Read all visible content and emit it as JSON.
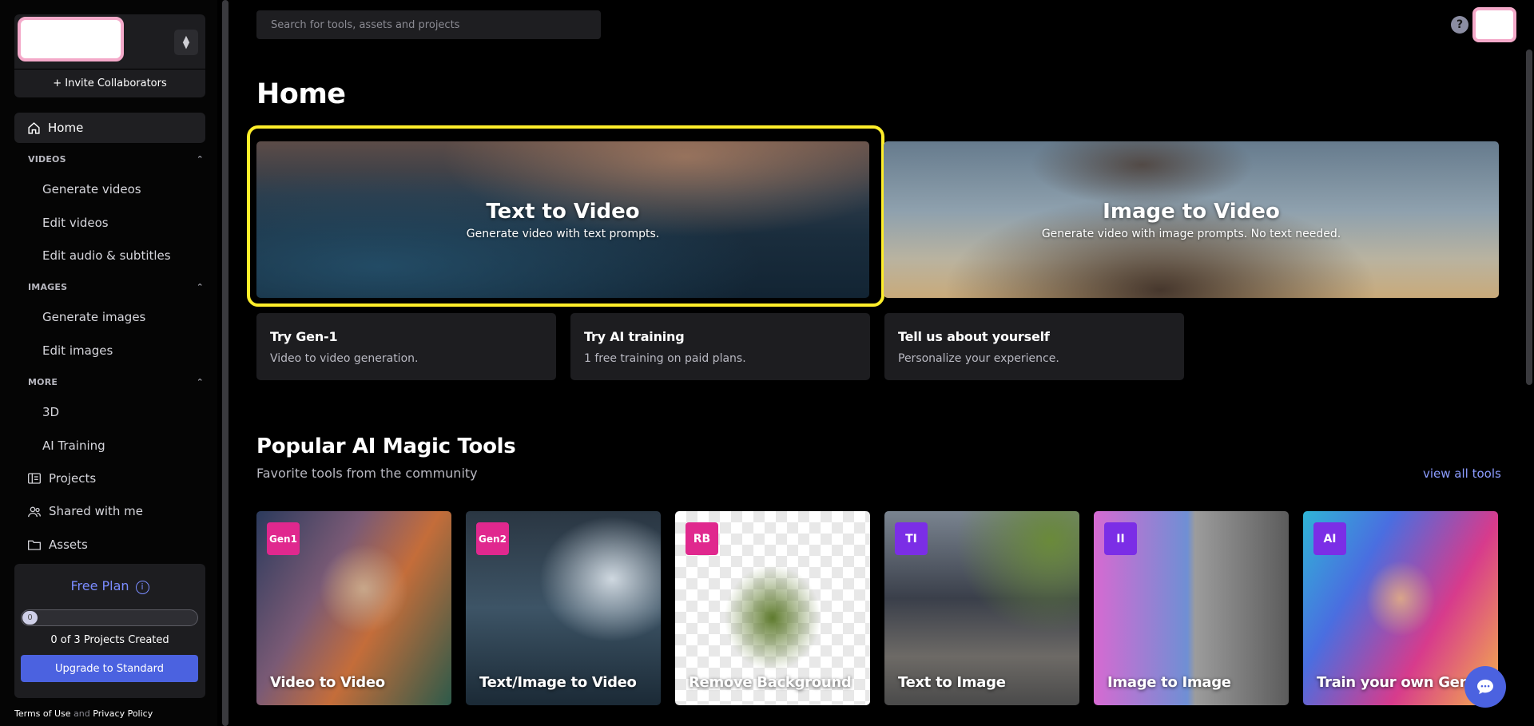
{
  "sidebar": {
    "invite_label": "+ Invite Collaborators",
    "home_label": "Home",
    "sections": [
      {
        "title": "VIDEOS",
        "items": [
          "Generate videos",
          "Edit videos",
          "Edit audio & subtitles"
        ]
      },
      {
        "title": "IMAGES",
        "items": [
          "Generate images",
          "Edit images"
        ]
      },
      {
        "title": "MORE",
        "items": [
          "3D",
          "AI Training"
        ]
      }
    ],
    "links": [
      "Projects",
      "Shared with me",
      "Assets"
    ],
    "plan": {
      "title": "Free Plan",
      "progress_value": "0",
      "progress_fraction": 0,
      "projects_text": "0 of 3 Projects Created",
      "upgrade_label": "Upgrade to Standard"
    },
    "legal": {
      "terms": "Terms of Use",
      "and": "and",
      "privacy": "Privacy Policy"
    }
  },
  "topbar": {
    "search_placeholder": "Search for tools, assets and projects",
    "help_label": "?"
  },
  "main": {
    "title": "Home",
    "heroes": [
      {
        "title": "Text to Video",
        "subtitle": "Generate video with text prompts."
      },
      {
        "title": "Image to Video",
        "subtitle": "Generate video with image prompts. No text needed."
      }
    ],
    "promos": [
      {
        "title": "Try Gen-1",
        "subtitle": "Video to video generation."
      },
      {
        "title": "Try AI training",
        "subtitle": "1 free training on paid plans."
      },
      {
        "title": "Tell us about yourself",
        "subtitle": "Personalize your experience."
      }
    ],
    "tools_section": {
      "title": "Popular AI Magic Tools",
      "subtitle": "Favorite tools from the community",
      "view_all": "view all tools"
    },
    "tools": [
      {
        "badge": "Gen1",
        "label": "Video to Video",
        "badge_color": "#e0288e"
      },
      {
        "badge": "Gen2",
        "label": "Text/Image to Video",
        "badge_color": "#e0288e"
      },
      {
        "badge": "RB",
        "label": "Remove Background",
        "badge_color": "#e0288e"
      },
      {
        "badge": "TI",
        "label": "Text to Image",
        "badge_color": "#7b2ee6"
      },
      {
        "badge": "II",
        "label": "Image to Image",
        "badge_color": "#7b2ee6"
      },
      {
        "badge": "AI",
        "label": "Train your own Generator",
        "badge_color": "#7b2ee6"
      }
    ]
  },
  "colors": {
    "accent": "#4b62e0",
    "link": "#8c9cff",
    "highlight": "#ffee2a"
  }
}
